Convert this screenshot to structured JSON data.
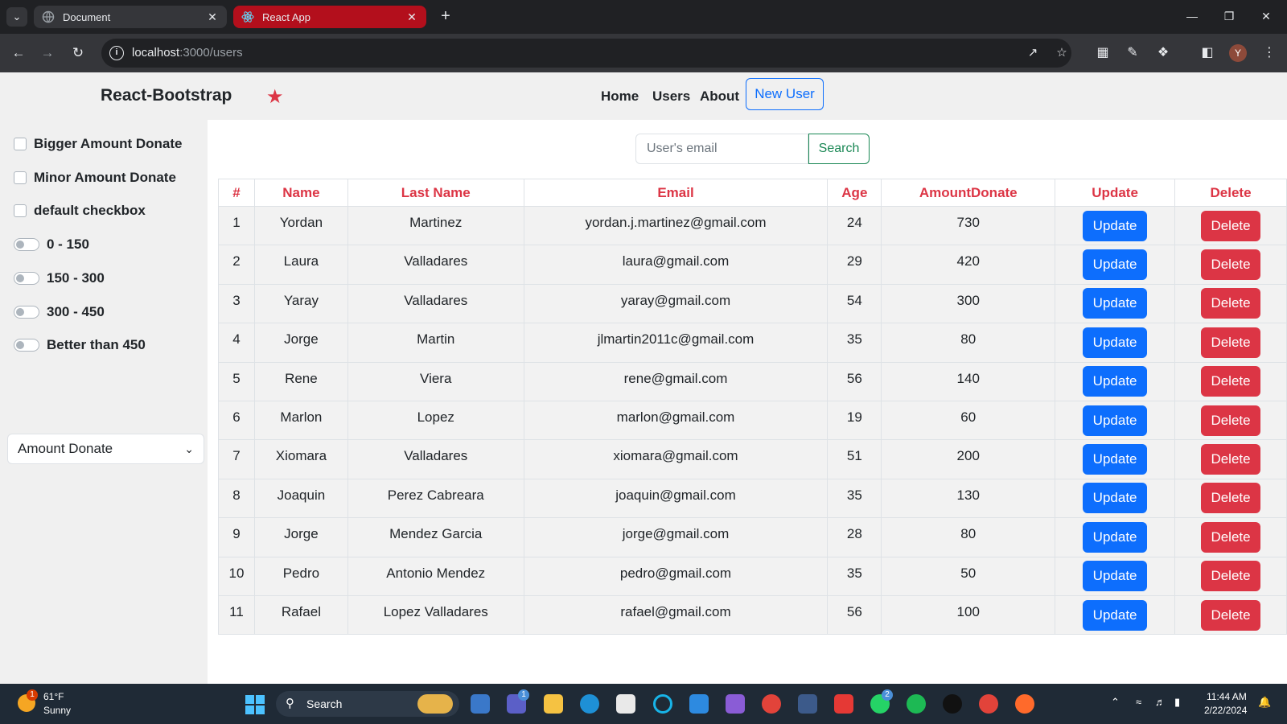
{
  "browser": {
    "tabs": [
      {
        "title": "Document",
        "active": false
      },
      {
        "title": "React App",
        "active": true
      }
    ],
    "url_host": "localhost",
    "url_path": ":3000/users",
    "profile_initial": "Y"
  },
  "navbar": {
    "brand": "React-Bootstrap",
    "links": [
      "Home",
      "Users",
      "About"
    ],
    "new_user_label": "New User"
  },
  "sidebar": {
    "checkboxes": [
      "Bigger Amount Donate",
      "Minor Amount Donate",
      "default checkbox"
    ],
    "switches": [
      "0 - 150",
      "150 - 300",
      "300 - 450",
      "Better than 450"
    ],
    "select_value": "Amount Donate"
  },
  "search": {
    "placeholder": "User's email",
    "button_label": "Search"
  },
  "table": {
    "headers": [
      "#",
      "Name",
      "Last Name",
      "Email",
      "Age",
      "AmountDonate",
      "Update",
      "Delete"
    ],
    "update_label": "Update",
    "delete_label": "Delete",
    "rows": [
      {
        "id": "1",
        "name": "Yordan",
        "last_name": "Martinez",
        "email": "yordan.j.martinez@gmail.com",
        "age": "24",
        "amount": "730"
      },
      {
        "id": "2",
        "name": "Laura",
        "last_name": "Valladares",
        "email": "laura@gmail.com",
        "age": "29",
        "amount": "420"
      },
      {
        "id": "3",
        "name": "Yaray",
        "last_name": "Valladares",
        "email": "yaray@gmail.com",
        "age": "54",
        "amount": "300"
      },
      {
        "id": "4",
        "name": "Jorge",
        "last_name": "Martin",
        "email": "jlmartin2011c@gmail.com",
        "age": "35",
        "amount": "80"
      },
      {
        "id": "5",
        "name": "Rene",
        "last_name": "Viera",
        "email": "rene@gmail.com",
        "age": "56",
        "amount": "140"
      },
      {
        "id": "6",
        "name": "Marlon",
        "last_name": "Lopez",
        "email": "marlon@gmail.com",
        "age": "19",
        "amount": "60"
      },
      {
        "id": "7",
        "name": "Xiomara",
        "last_name": "Valladares",
        "email": "xiomara@gmail.com",
        "age": "51",
        "amount": "200"
      },
      {
        "id": "8",
        "name": "Joaquin",
        "last_name": "Perez Cabreara",
        "email": "joaquin@gmail.com",
        "age": "35",
        "amount": "130"
      },
      {
        "id": "9",
        "name": "Jorge",
        "last_name": "Mendez Garcia",
        "email": "jorge@gmail.com",
        "age": "28",
        "amount": "80"
      },
      {
        "id": "10",
        "name": "Pedro",
        "last_name": "Antonio Mendez",
        "email": "pedro@gmail.com",
        "age": "35",
        "amount": "50"
      },
      {
        "id": "11",
        "name": "Rafael",
        "last_name": "Lopez Valladares",
        "email": "rafael@gmail.com",
        "age": "56",
        "amount": "100"
      }
    ]
  },
  "taskbar": {
    "weather_temp": "61°F",
    "weather_condition": "Sunny",
    "weather_badge": "1",
    "search_label": "Search",
    "teams_badge": "1",
    "whatsapp_badge": "2",
    "time": "11:44 AM",
    "date": "2/22/2024"
  },
  "colors": {
    "accent_red": "#dc3545",
    "primary_blue": "#0d6efd",
    "success_green": "#198754",
    "active_tab": "#b30f1c"
  }
}
